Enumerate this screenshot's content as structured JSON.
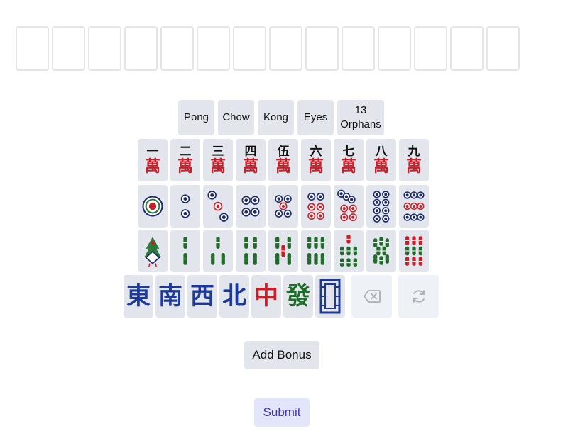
{
  "hand": {
    "slot_count": 14
  },
  "melds": [
    {
      "label": "Pong"
    },
    {
      "label": "Chow"
    },
    {
      "label": "Kong"
    },
    {
      "label": "Eyes"
    },
    {
      "label": "13 Orphans"
    }
  ],
  "characters": {
    "suit_glyph": "萬",
    "numerals": [
      "一",
      "二",
      "三",
      "四",
      "伍",
      "六",
      "七",
      "八",
      "九"
    ]
  },
  "circles": {
    "values": [
      1,
      2,
      3,
      4,
      5,
      6,
      7,
      8,
      9
    ]
  },
  "bamboos": {
    "values": [
      1,
      2,
      3,
      4,
      5,
      6,
      7,
      8,
      9
    ]
  },
  "honors": [
    {
      "glyph": "東",
      "color": "#1d3a9a",
      "name": "east"
    },
    {
      "glyph": "南",
      "color": "#1d3a9a",
      "name": "south"
    },
    {
      "glyph": "西",
      "color": "#1d3a9a",
      "name": "west"
    },
    {
      "glyph": "北",
      "color": "#1d3a9a",
      "name": "north"
    },
    {
      "glyph": "中",
      "color": "#c8202a",
      "name": "red-dragon"
    },
    {
      "glyph": "發",
      "color": "#1f6b2a",
      "name": "green-dragon"
    }
  ],
  "actions": {
    "backspace_icon": "backspace-icon",
    "reset_icon": "refresh-icon"
  },
  "buttons": {
    "add_bonus": "Add Bonus",
    "submit": "Submit"
  },
  "colors": {
    "tile_bg": "#e2e6ec",
    "submit_text": "#3f3ab8",
    "submit_bg": "#e3e6fb"
  }
}
